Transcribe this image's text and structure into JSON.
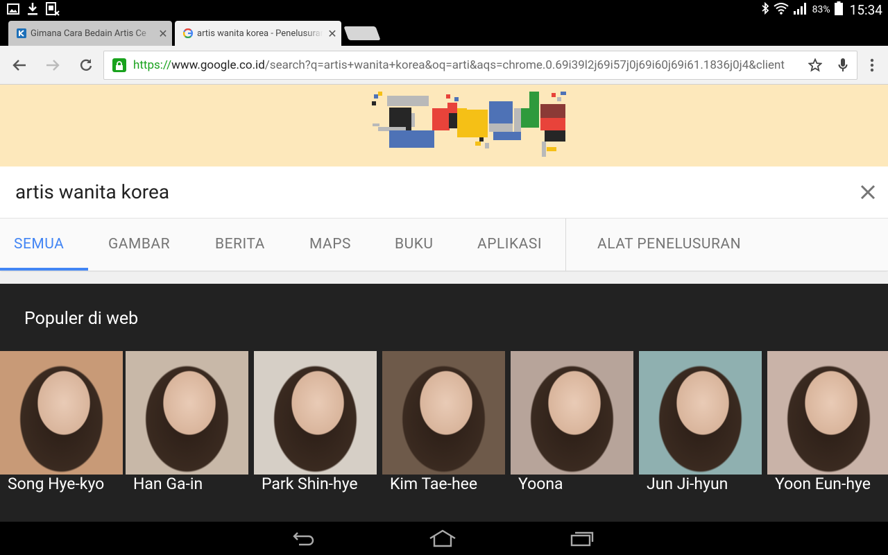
{
  "status_bar": {
    "left_icons": [
      "image-notification-icon",
      "download-icon",
      "sim-off-icon"
    ],
    "right_icons": [
      "bluetooth-icon",
      "wifi-icon",
      "signal-icon",
      "battery-icon"
    ],
    "battery": "83%",
    "time": "15:34"
  },
  "browser": {
    "tabs": [
      {
        "title": "Gimana Cara Bedain Artis Ce",
        "favicon": "kaskus-favicon",
        "active": false
      },
      {
        "title": "artis wanita korea - Penelusuran",
        "favicon": "google-favicon",
        "active": true
      }
    ],
    "url": {
      "scheme": "https://",
      "host": "www.google.co.id",
      "path": "/search?q=artis+wanita+korea&oq=arti&aqs=chrome.0.69i39l2j69i57j0j69i60j69i61.1836j0j4&client"
    }
  },
  "search": {
    "query": "artis wanita korea",
    "tabs": [
      {
        "label": "SEMUA",
        "active": true
      },
      {
        "label": "GAMBAR"
      },
      {
        "label": "BERITA"
      },
      {
        "label": "MAPS"
      },
      {
        "label": "BUKU"
      },
      {
        "label": "APLIKASI"
      }
    ],
    "tools_label": "ALAT PENELUSURAN"
  },
  "popular": {
    "title": "Populer di web",
    "items": [
      {
        "name": "Song Hye-kyo",
        "bg": "#c89a77"
      },
      {
        "name": "Han Ga-in",
        "bg": "#c8b8a8"
      },
      {
        "name": "Park Shin-hye",
        "bg": "#d6cfc6"
      },
      {
        "name": "Kim Tae-hee",
        "bg": "#6e5a4a"
      },
      {
        "name": "Yoona",
        "bg": "#b7a49a"
      },
      {
        "name": "Jun Ji-hyun",
        "bg": "#8fb0b0"
      },
      {
        "name": "Yoon Eun-hye",
        "bg": "#c9b3a8"
      }
    ]
  },
  "colors": {
    "accent": "#4285f4",
    "doodle_bg": "#fde8bb",
    "secure_green": "#19a21d"
  }
}
